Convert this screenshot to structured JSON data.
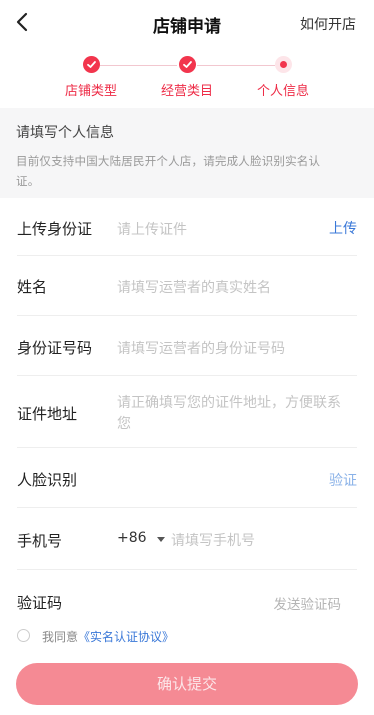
{
  "header": {
    "title": "店铺申请",
    "help_label": "如何开店"
  },
  "steps": [
    {
      "label": "店铺类型",
      "state": "done"
    },
    {
      "label": "经营类目",
      "state": "done"
    },
    {
      "label": "个人信息",
      "state": "current"
    }
  ],
  "notice": {
    "title": "请填写个人信息",
    "desc_line1": "目前仅支持中国大陆居民开个人店，请完成人脸识别实名认",
    "desc_line2": "证。"
  },
  "form": {
    "id_upload": {
      "label": "上传身份证",
      "placeholder": "请上传证件",
      "action": "上传"
    },
    "name": {
      "label": "姓名",
      "placeholder": "请填写运营者的真实姓名"
    },
    "id_number": {
      "label": "身份证号码",
      "placeholder": "请填写运营者的身份证号码"
    },
    "address": {
      "label": "证件地址",
      "placeholder_line1": "请正确填写您的证件地址，方便联系",
      "placeholder_line2": "您"
    },
    "face": {
      "label": "人脸识别",
      "action": "验证"
    },
    "phone": {
      "label": "手机号",
      "country_code": "+86",
      "placeholder": "请填写手机号"
    },
    "code": {
      "label": "验证码",
      "action": "发送验证码"
    }
  },
  "agreement": {
    "prefix": "我同意",
    "link": "《实名认证协议》"
  },
  "submit_label": "确认提交",
  "colors": {
    "accent": "#f2354d",
    "link": "#3a78d8",
    "submit_bg": "#f58a94"
  }
}
